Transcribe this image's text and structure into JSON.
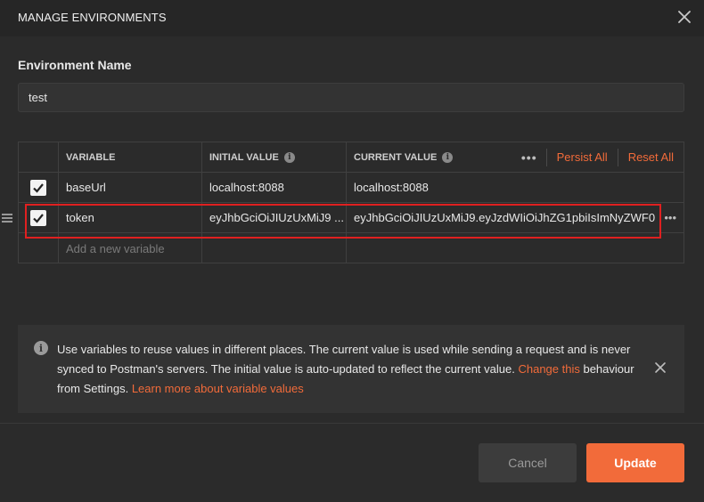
{
  "dialog": {
    "title": "MANAGE ENVIRONMENTS"
  },
  "environment": {
    "label": "Environment Name",
    "value": "test"
  },
  "table": {
    "headers": {
      "variable": "VARIABLE",
      "initial_value": "INITIAL VALUE",
      "current_value": "CURRENT VALUE"
    },
    "actions": {
      "more": "•••",
      "persist_all": "Persist All",
      "reset_all": "Reset All"
    },
    "rows": [
      {
        "checked": true,
        "variable": "baseUrl",
        "initial": "localhost:8088",
        "current": "localhost:8088"
      },
      {
        "checked": true,
        "variable": "token",
        "initial": "eyJhbGciOiJIUzUxMiJ9 ...",
        "current": "eyJhbGciOiJIUzUxMiJ9.eyJzdWIiOiJhZG1pbiIsImNyZWF0"
      }
    ],
    "new_row_placeholder": "Add a new variable",
    "row_more": "•••"
  },
  "notice": {
    "text_1": "Use variables to reuse values in different places. The current value is used while sending a request and is never synced to Postman's servers. The initial value is auto-updated to reflect the current value. ",
    "link_change": "Change this",
    "text_2": " behaviour from Settings. ",
    "link_learn": "Learn more about variable values"
  },
  "buttons": {
    "cancel": "Cancel",
    "update": "Update"
  },
  "colors": {
    "accent": "#f26b3a",
    "highlight_box": "#e02020",
    "background": "#2b2b2b"
  }
}
